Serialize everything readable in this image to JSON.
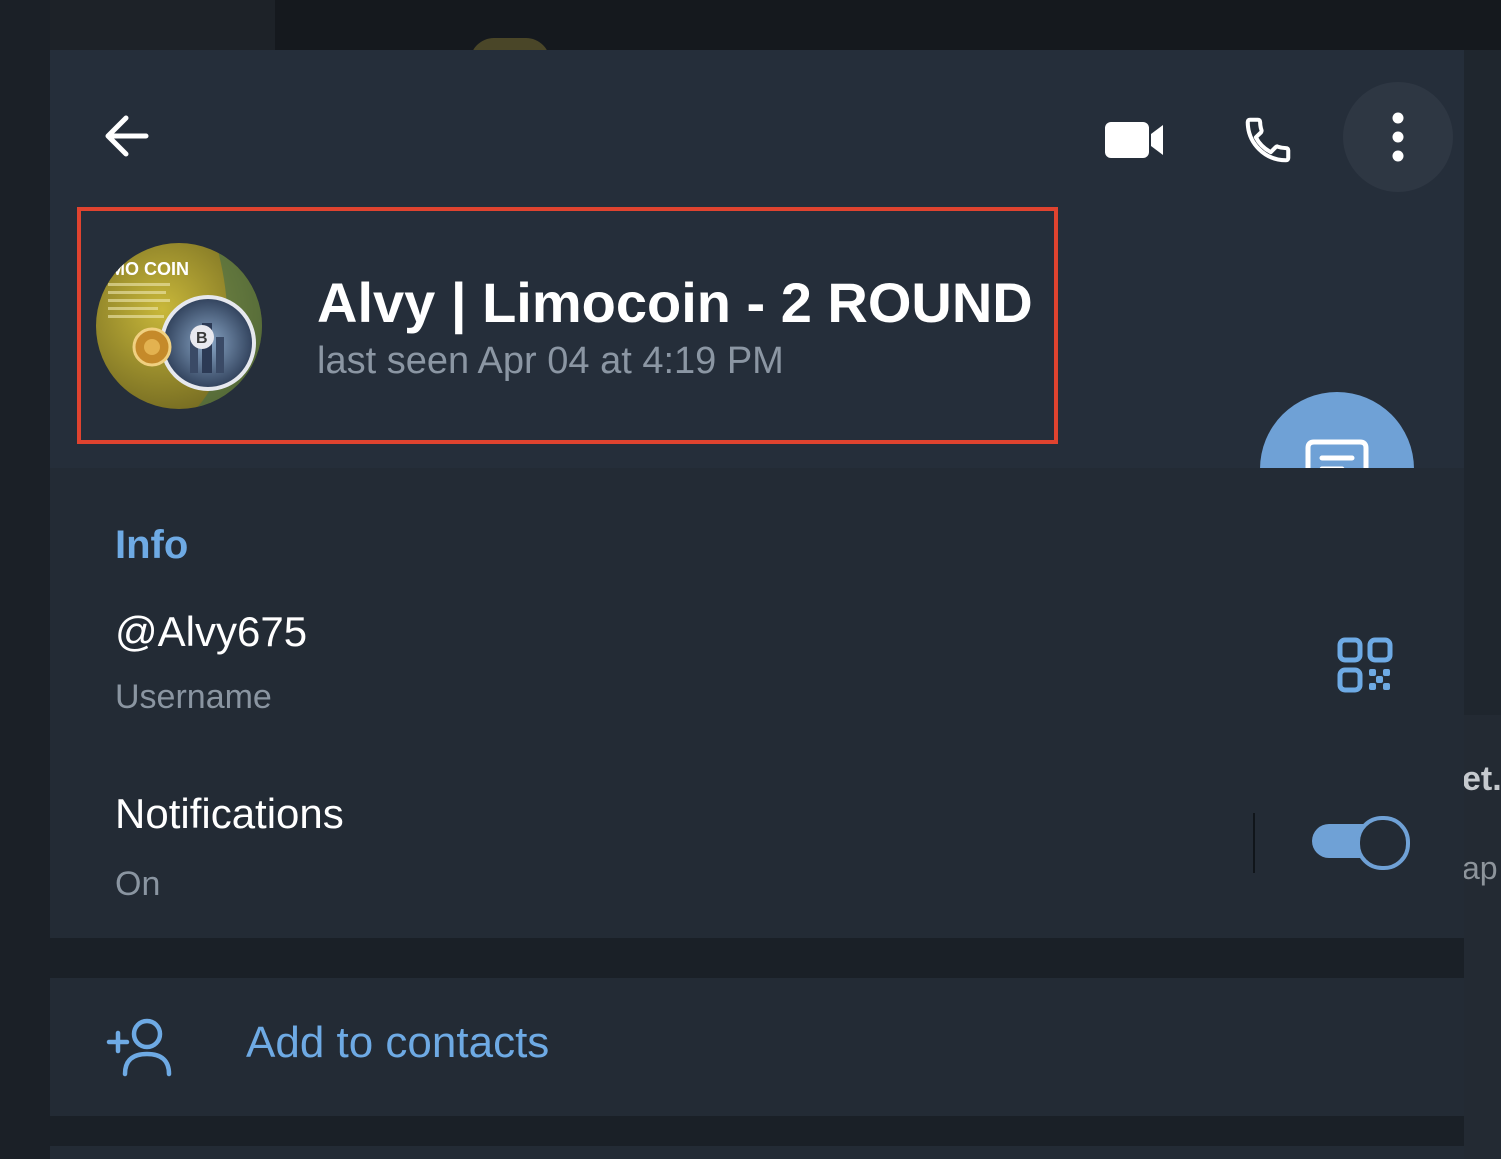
{
  "header": {
    "back_icon": "arrow-left-icon",
    "video_icon": "video-camera-icon",
    "call_icon": "phone-icon",
    "more_icon": "more-vertical-icon"
  },
  "profile": {
    "name": "Alvy | Limocoin - 2 ROUND",
    "status": "last seen Apr 04 at 4:19 PM",
    "avatar_text": "MO COIN",
    "avatar_badge": "B"
  },
  "fab": {
    "icon": "message-icon"
  },
  "info": {
    "title": "Info",
    "username": "@Alvy675",
    "username_label": "Username",
    "qr_icon": "qr-code-icon",
    "notifications_title": "Notifications",
    "notifications_status": "On",
    "notifications_enabled": true
  },
  "actions": {
    "add_contact_label": "Add to contacts",
    "add_contact_icon": "add-user-icon"
  },
  "background": {
    "right_text_1": "et.",
    "right_text_2": "ap"
  },
  "colors": {
    "accent": "#6eaae4",
    "fab": "#6fa1d6",
    "highlight": "#e0432f",
    "panel": "#232b35"
  }
}
